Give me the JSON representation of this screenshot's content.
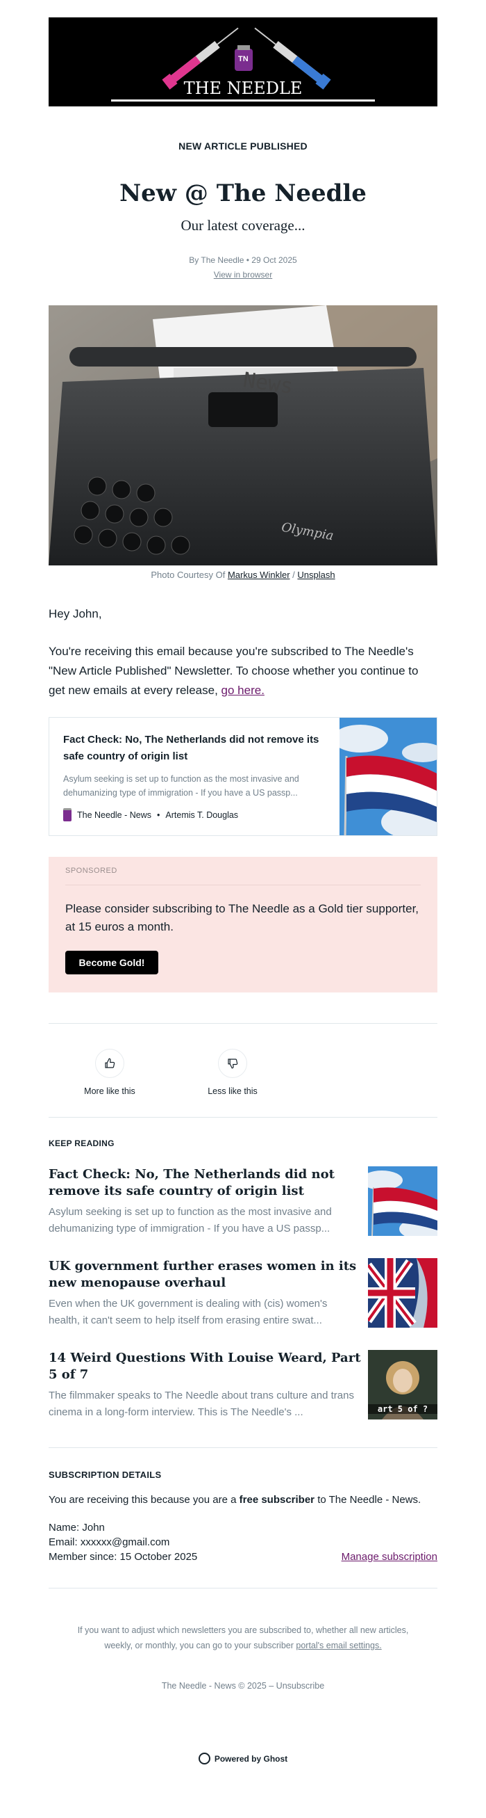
{
  "brand": {
    "logo_text": "THE NEEDLE",
    "logo_badge": "TN"
  },
  "header": {
    "kicker": "NEW ARTICLE PUBLISHED",
    "title": "New @ The Needle",
    "subtitle": "Our latest coverage...",
    "byline": "By The Needle • 29 Oct 2025",
    "view_in_browser": "View in browser"
  },
  "hero": {
    "paper_text": "News",
    "typewriter_brand": "Olympia",
    "caption_prefix": "Photo Courtesy Of",
    "caption_author": "Markus Winkler",
    "caption_sep": "/",
    "caption_source": "Unsplash"
  },
  "body": {
    "greeting": "Hey John,",
    "intro": "You're receiving this email because you're subscribed to The Needle's \"New Article Published\" Newsletter. To choose whether you continue to get new emails at every release,",
    "intro_link": "go here."
  },
  "feature_card": {
    "title": "Fact Check: No, The Netherlands did not remove its safe country of origin list",
    "excerpt": "Asylum seeking is set up to function as the most invasive and dehumanizing type of immigration - If you have a US passp...",
    "publication": "The Needle - News",
    "dot": "•",
    "author": "Artemis T. Douglas"
  },
  "sponsor": {
    "label": "SPONSORED",
    "text": "Please consider subscribing to The Needle as a Gold tier supporter, at 15 euros a month.",
    "button": "Become Gold!"
  },
  "feedback": {
    "more": "More like this",
    "less": "Less like this"
  },
  "keep_reading": {
    "heading": "KEEP READING",
    "items": [
      {
        "title": "Fact Check: No, The Netherlands did not remove its safe country of origin list",
        "excerpt": "Asylum seeking is set up to function as the most invasive and dehumanizing type of immigration - If you have a US passp..."
      },
      {
        "title": "UK government further erases women in its new menopause overhaul",
        "excerpt": "Even when the UK government is dealing with (cis) women's health, it can't seem to help itself from erasing entire swat..."
      },
      {
        "title": "14 Weird Questions With Louise Weard, Part 5 of 7",
        "excerpt": "The filmmaker speaks to The Needle about trans culture and trans cinema in a long-form interview. This is The Needle's ...",
        "image_text": "art 5 of ?"
      }
    ]
  },
  "subscription": {
    "heading": "SUBSCRIPTION DETAILS",
    "line_prefix": "You are receiving this because you are a",
    "tier": "free subscriber",
    "line_suffix": "to The Needle - News.",
    "name": "Name: John",
    "email": "Email: xxxxxx@gmail.com",
    "since": "Member since: 15 October 2025",
    "manage": "Manage subscription"
  },
  "footer": {
    "text": "If you want to adjust which newsletters you are subscribed to, whether all new articles, weekly, or monthly, you can go to your subscriber",
    "link": "portal's email settings.",
    "copyright": "The Needle - News © 2025 – Unsubscribe",
    "powered": "Powered by Ghost"
  },
  "colors": {
    "accent_link": "#6b1a6b",
    "sponsor_bg": "#fbe5e3",
    "muted": "#73818c"
  }
}
